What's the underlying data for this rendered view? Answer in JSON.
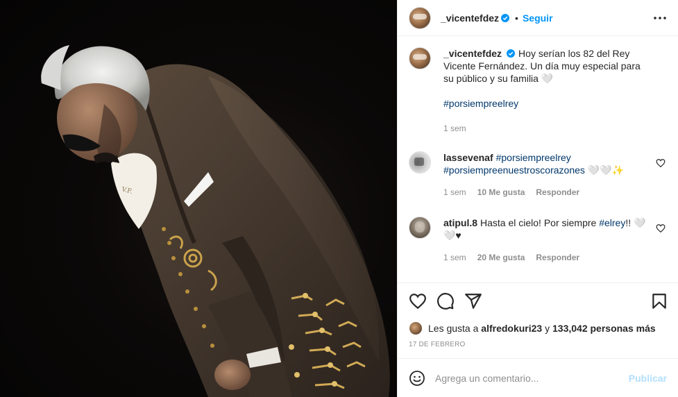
{
  "post": {
    "username": "_vicentefdez",
    "follow_label": "Seguir",
    "separator": "•",
    "caption_text": "Hoy serían los 82 del Rey Vicente Fernández. Un día muy especial para su público y su familia 🤍",
    "caption_hashtag": "#porsiempreelrey",
    "caption_time": "1 sem"
  },
  "comments": [
    {
      "username": "lassevenaf",
      "hashtag_1": "#porsiempreelrey",
      "hashtag_2": "#porsiempreenuestroscorazones",
      "trailing": " 🤍🤍✨",
      "time": "1 sem",
      "likes": "10 Me gusta",
      "reply": "Responder"
    },
    {
      "username": "atipul.8",
      "text": "Hasta el cielo! Por siempre ",
      "hashtag": "#elrey",
      "trailing": "!! 🤍🤍♥",
      "time": "1 sem",
      "likes": "20 Me gusta",
      "reply": "Responder"
    }
  ],
  "likes": {
    "prefix": "Les gusta a ",
    "user": "alfredokuri23",
    "middle": " y ",
    "count": "133,042 personas más"
  },
  "date": "17 DE FEBRERO",
  "composer": {
    "placeholder": "Agrega un comentario...",
    "publish_label": "Publicar"
  },
  "colors": {
    "accent": "#0095f6",
    "hashtag": "#00376b",
    "muted": "#8e8e8e",
    "publish_disabled": "#b2dffc"
  },
  "icons": [
    "verified-badge-icon",
    "more-options-icon",
    "heart-icon",
    "comment-icon",
    "share-icon",
    "bookmark-icon",
    "emoji-icon"
  ]
}
